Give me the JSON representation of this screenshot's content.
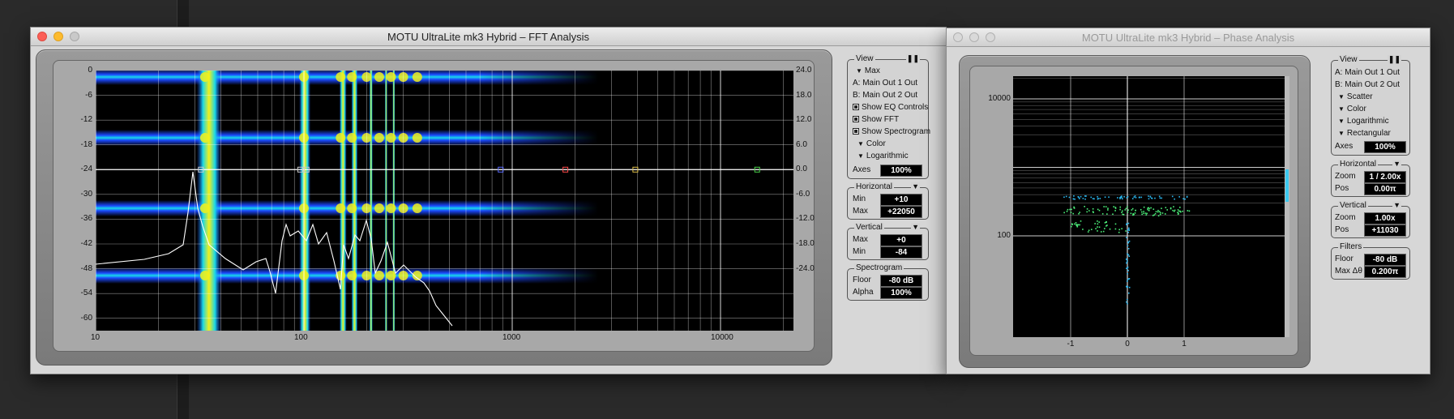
{
  "fft_window": {
    "title": "MOTU UltraLite mk3 Hybrid – FFT Analysis",
    "left_axis_labels": [
      "0",
      "-6",
      "-12",
      "-18",
      "-24",
      "-30",
      "-36",
      "-42",
      "-48",
      "-54",
      "-60"
    ],
    "right_axis_labels": [
      "24.0",
      "18.0",
      "12.0",
      "6.0",
      "0.0",
      "-6.0",
      "-12.0",
      "-18.0",
      "-24.0"
    ],
    "x_axis_labels": [
      "10",
      "100",
      "1000",
      "10000"
    ],
    "view": {
      "title": "View",
      "max_label": "Max",
      "a_label": "A: Main Out 1 Out",
      "b_label": "B: Main Out 2 Out",
      "show_eq": "Show EQ Controls",
      "show_fft": "Show FFT",
      "show_spectrogram": "Show Spectrogram",
      "color": "Color",
      "logarithmic": "Logarithmic",
      "axes_label": "Axes",
      "axes_value": "100%"
    },
    "horizontal": {
      "title": "Horizontal",
      "min_label": "Min",
      "min_value": "+10",
      "max_label": "Max",
      "max_value": "+22050"
    },
    "vertical": {
      "title": "Vertical",
      "max_label": "Max",
      "max_value": "+0",
      "min_label": "Min",
      "min_value": "-84"
    },
    "spectrogram": {
      "title": "Spectrogram",
      "floor_label": "Floor",
      "floor_value": "-80 dB",
      "alpha_label": "Alpha",
      "alpha_value": "100%"
    },
    "pause_icon": "pause-icon"
  },
  "phase_window": {
    "title": "MOTU UltraLite mk3 Hybrid – Phase Analysis",
    "y_axis_labels": [
      "10000",
      "100"
    ],
    "x_axis_labels": [
      "-1",
      "0",
      "1"
    ],
    "view": {
      "title": "View",
      "a_label": "A: Main Out 1 Out",
      "b_label": "B: Main Out 2 Out",
      "scatter": "Scatter",
      "color": "Color",
      "logarithmic": "Logarithmic",
      "rectangular": "Rectangular",
      "axes_label": "Axes",
      "axes_value": "100%"
    },
    "horizontal": {
      "title": "Horizontal",
      "zoom_label": "Zoom",
      "zoom_value": "1 / 2.00x",
      "pos_label": "Pos",
      "pos_value": "0.00π"
    },
    "vertical": {
      "title": "Vertical",
      "zoom_label": "Zoom",
      "zoom_value": "1.00x",
      "pos_label": "Pos",
      "pos_value": "+11030"
    },
    "filters": {
      "title": "Filters",
      "floor_label": "Floor",
      "floor_value": "-80 dB",
      "maxdelta_label": "Max Δθ",
      "maxdelta_value": "0.200π"
    }
  },
  "colors": {
    "spectrum_yellow": "#f2f01a",
    "spectrum_cyan": "#18d8e8",
    "spectrum_blue": "#1b49ff",
    "phase_green": "#4cf07a",
    "phase_cyan": "#2bb8f0"
  }
}
